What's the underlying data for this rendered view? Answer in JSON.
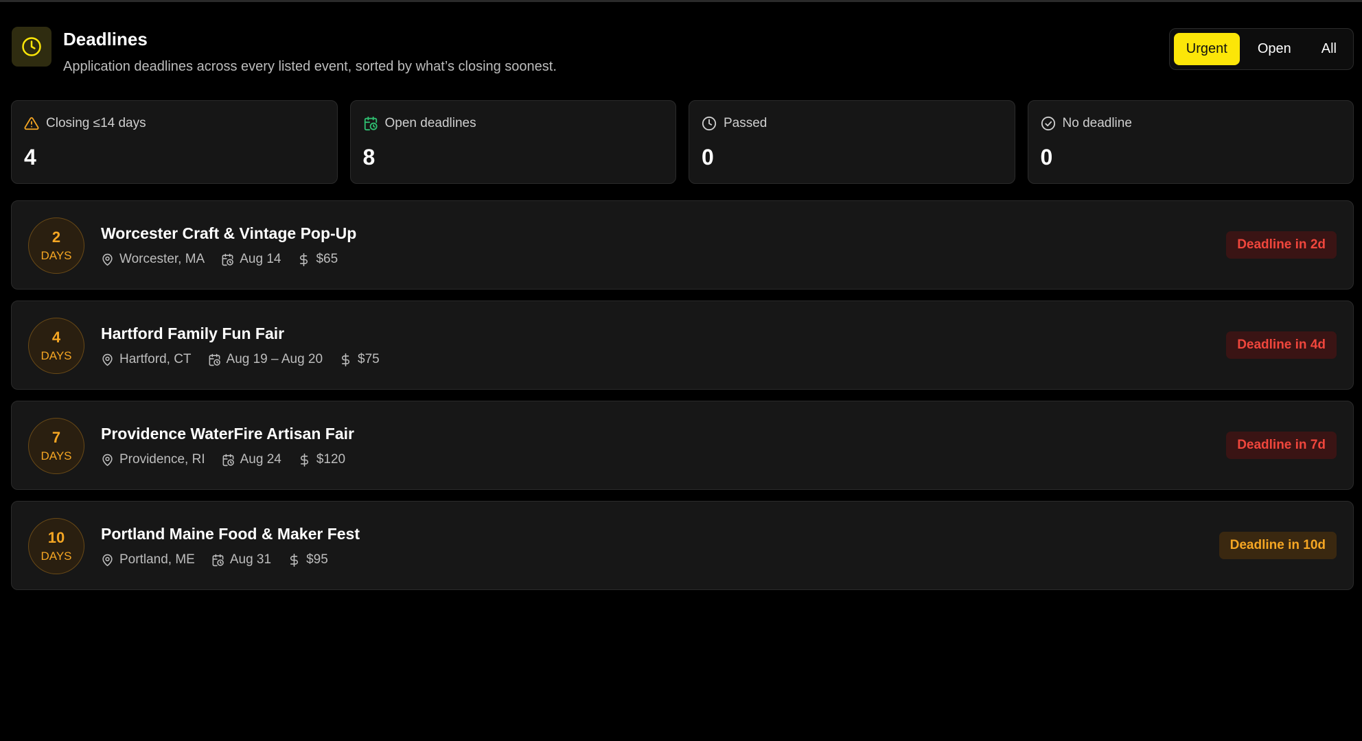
{
  "header": {
    "icon": "clock-icon",
    "title": "Deadlines",
    "subtitle": "Application deadlines across every listed event, sorted by what’s closing soonest."
  },
  "filters": {
    "options": [
      "Urgent",
      "Open",
      "All"
    ],
    "selected": "Urgent"
  },
  "stats": [
    {
      "icon": "warning-icon",
      "icon_color": "#f5a623",
      "label": "Closing ≤14 days",
      "value": "4"
    },
    {
      "icon": "calendar-clock-icon",
      "icon_color": "#2fbf71",
      "label": "Open deadlines",
      "value": "8"
    },
    {
      "icon": "clock-icon",
      "icon_color": "#cfcfcf",
      "label": "Passed",
      "value": "0"
    },
    {
      "icon": "check-circle-icon",
      "icon_color": "#cfcfcf",
      "label": "No deadline",
      "value": "0"
    }
  ],
  "events": [
    {
      "days": "2",
      "days_unit": "DAYS",
      "title": "Worcester Craft & Vintage Pop-Up",
      "location": "Worcester, MA",
      "dates": "Aug 14",
      "fee": "$65",
      "badge": "Deadline in 2d",
      "badge_tone": "red"
    },
    {
      "days": "4",
      "days_unit": "DAYS",
      "title": "Hartford Family Fun Fair",
      "location": "Hartford, CT",
      "dates": "Aug 19 – Aug 20",
      "fee": "$75",
      "badge": "Deadline in 4d",
      "badge_tone": "red"
    },
    {
      "days": "7",
      "days_unit": "DAYS",
      "title": "Providence WaterFire Artisan Fair",
      "location": "Providence, RI",
      "dates": "Aug 24",
      "fee": "$120",
      "badge": "Deadline in 7d",
      "badge_tone": "red"
    },
    {
      "days": "10",
      "days_unit": "DAYS",
      "title": "Portland Maine Food & Maker Fest",
      "location": "Portland, ME",
      "dates": "Aug 31",
      "fee": "$95",
      "badge": "Deadline in 10d",
      "badge_tone": "amber"
    }
  ],
  "colors": {
    "accent": "#fce608",
    "urgent_red": "#f0463c",
    "amber": "#f5a623",
    "open_green": "#2fbf71"
  }
}
